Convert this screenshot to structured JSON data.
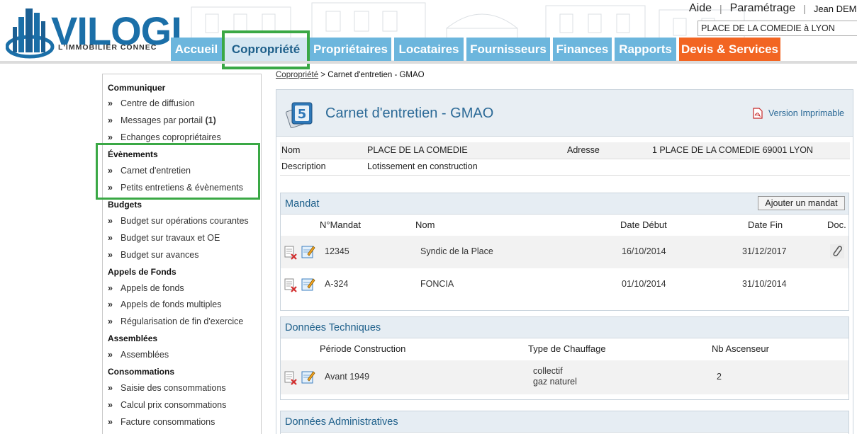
{
  "header": {
    "logo_text": "VILOGI",
    "logo_subtitle": "L'IMMOBILIER CONNEC",
    "links": {
      "help": "Aide",
      "settings": "Paramétrage",
      "user": "Jean DEM"
    },
    "search_value": "PLACE DE LA COMEDIE à LYON",
    "tabs": [
      {
        "label": "Accueil",
        "state": "normal"
      },
      {
        "label": "Copropriété",
        "state": "active"
      },
      {
        "label": "Propriétaires",
        "state": "normal"
      },
      {
        "label": "Locataires",
        "state": "normal"
      },
      {
        "label": "Fournisseurs",
        "state": "normal"
      },
      {
        "label": "Finances",
        "state": "normal"
      },
      {
        "label": "Rapports",
        "state": "normal"
      },
      {
        "label": "Devis & Services",
        "state": "highlight"
      }
    ],
    "colors": {
      "tab": "#6cb6dd",
      "tab_active": "#d4e6f1",
      "tab_orange": "#f26522",
      "annotation": "#3aa845"
    }
  },
  "sidebar": {
    "sections": [
      {
        "title": "Communiquer",
        "items": [
          "Centre de diffusion",
          "Messages par portail",
          "Echanges copropriétaires"
        ],
        "badge": "(1)"
      },
      {
        "title": "Évènements",
        "items": [
          "Carnet d'entretien",
          "Petits entretiens & évènements"
        ]
      },
      {
        "title": "Budgets",
        "items": [
          "Budget sur opérations courantes",
          "Budget sur travaux et OE",
          "Budget sur avances"
        ]
      },
      {
        "title": "Appels de Fonds",
        "items": [
          "Appels de fonds",
          "Appels de fonds multiples",
          "Régularisation de fin d'exercice"
        ]
      },
      {
        "title": "Assemblées",
        "items": [
          "Assemblées"
        ]
      },
      {
        "title": "Consommations",
        "items": [
          "Saisie des consommations",
          "Calcul prix consommations",
          "Facture consommations"
        ]
      }
    ],
    "bullet": "»"
  },
  "breadcrumb": {
    "link": "Copropriété",
    "separator": " > ",
    "current": "Carnet d'entretien - GMAO"
  },
  "main": {
    "title": "Carnet d'entretien - GMAO",
    "print_label": "Version Imprimable",
    "info": {
      "nom_label": "Nom",
      "nom_value": "PLACE DE LA COMEDIE",
      "adresse_label": "Adresse",
      "adresse_value": "1 PLACE DE LA COMEDIE 69001 LYON",
      "description_label": "Description",
      "description_value": "Lotissement en construction"
    },
    "mandat": {
      "title": "Mandat",
      "add_button": "Ajouter un mandat",
      "columns": [
        "N°Mandat",
        "Nom",
        "Date Début",
        "Date Fin",
        "Doc."
      ],
      "rows": [
        {
          "numero": "12345",
          "nom": "Syndic de la Place",
          "debut": "16/10/2014",
          "fin": "31/12/2017",
          "doc": "paperclip-icon"
        },
        {
          "numero": "A-324",
          "nom": "FONCIA",
          "debut": "01/10/2014",
          "fin": "31/10/2014",
          "doc": ""
        }
      ]
    },
    "technique": {
      "title": "Données Techniques",
      "columns": [
        "Période Construction",
        "Type de Chauffage",
        "Nb Ascenseur"
      ],
      "rows": [
        {
          "periode": "Avant 1949",
          "chauffage_1": "collectif",
          "chauffage_2": "gaz naturel",
          "ascenseurs": "2"
        }
      ]
    },
    "administratif": {
      "title": "Données Administratives"
    }
  }
}
